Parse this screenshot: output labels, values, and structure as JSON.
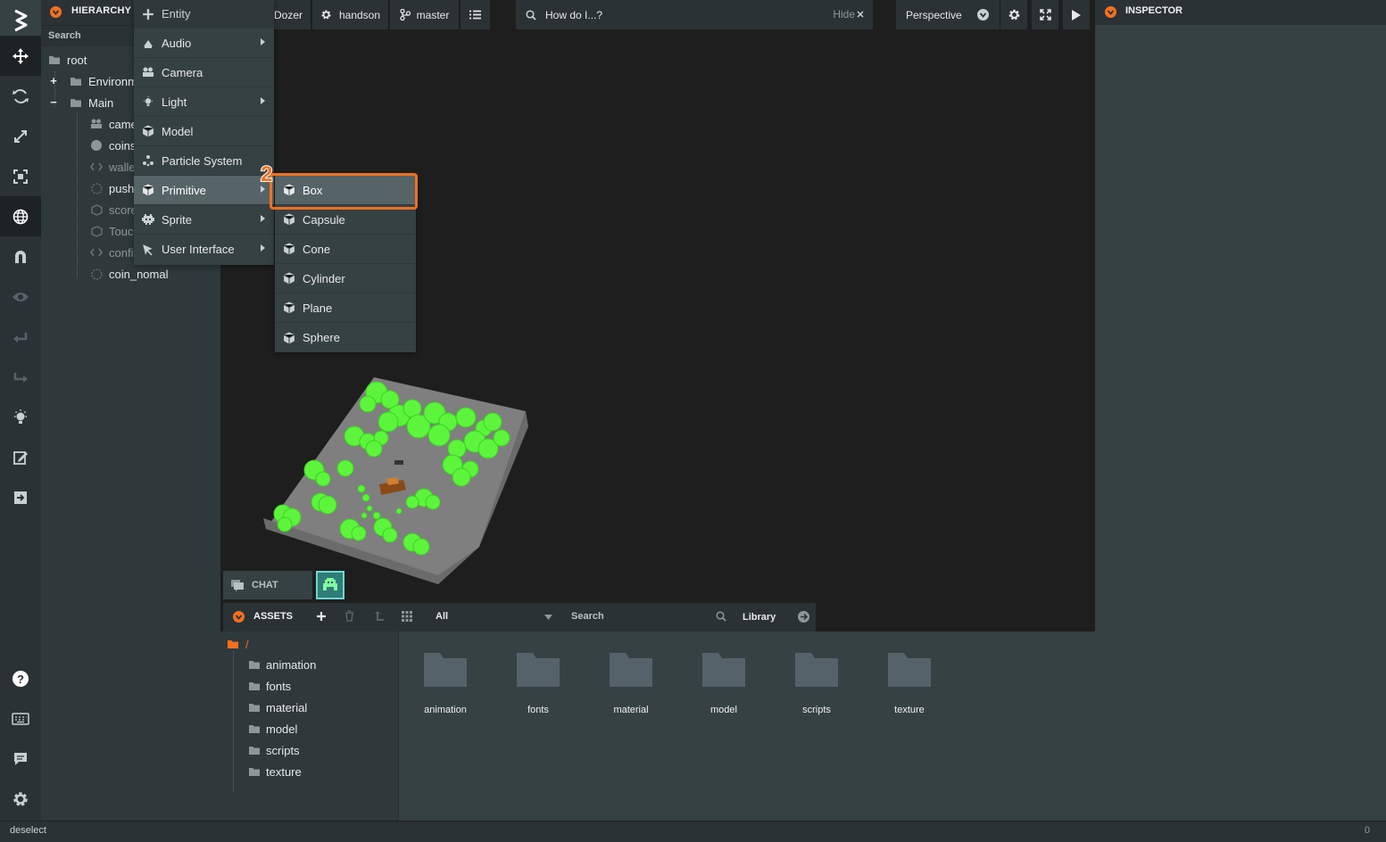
{
  "app": {
    "status_text": "deselect",
    "status_count": "0"
  },
  "hierarchy": {
    "title": "HIERARCHY",
    "search_label": "Search",
    "nodes": [
      "root",
      "Environm",
      "Main",
      "came",
      "coins",
      "walle",
      "push",
      "score",
      "Touc",
      "confi",
      "coin_nomal"
    ]
  },
  "topbar": {
    "project": "Dozer",
    "user": "handson",
    "branch": "master",
    "help_placeholder": "How do I...?",
    "hide_label": "Hide",
    "camera_mode": "Perspective"
  },
  "context_menu": {
    "header": "Entity",
    "items": [
      "Audio",
      "Camera",
      "Light",
      "Model",
      "Particle System",
      "Primitive",
      "Sprite",
      "User Interface"
    ]
  },
  "submenu": {
    "items": [
      "Box",
      "Capsule",
      "Cone",
      "Cylinder",
      "Plane",
      "Sphere"
    ],
    "step_badge": "2"
  },
  "chat": {
    "label": "CHAT"
  },
  "assets": {
    "title": "ASSETS",
    "filter": "All",
    "search_label": "Search",
    "library_label": "Library",
    "root_path": "/",
    "folders": [
      "animation",
      "fonts",
      "material",
      "model",
      "scripts",
      "texture"
    ]
  },
  "inspector": {
    "title": "INSPECTOR"
  },
  "colors": {
    "accent": "#f37021",
    "panel": "#364144",
    "dark_panel": "#2a3235",
    "viewport": "#1e1e1e",
    "tree_green": "#5cf53c"
  }
}
